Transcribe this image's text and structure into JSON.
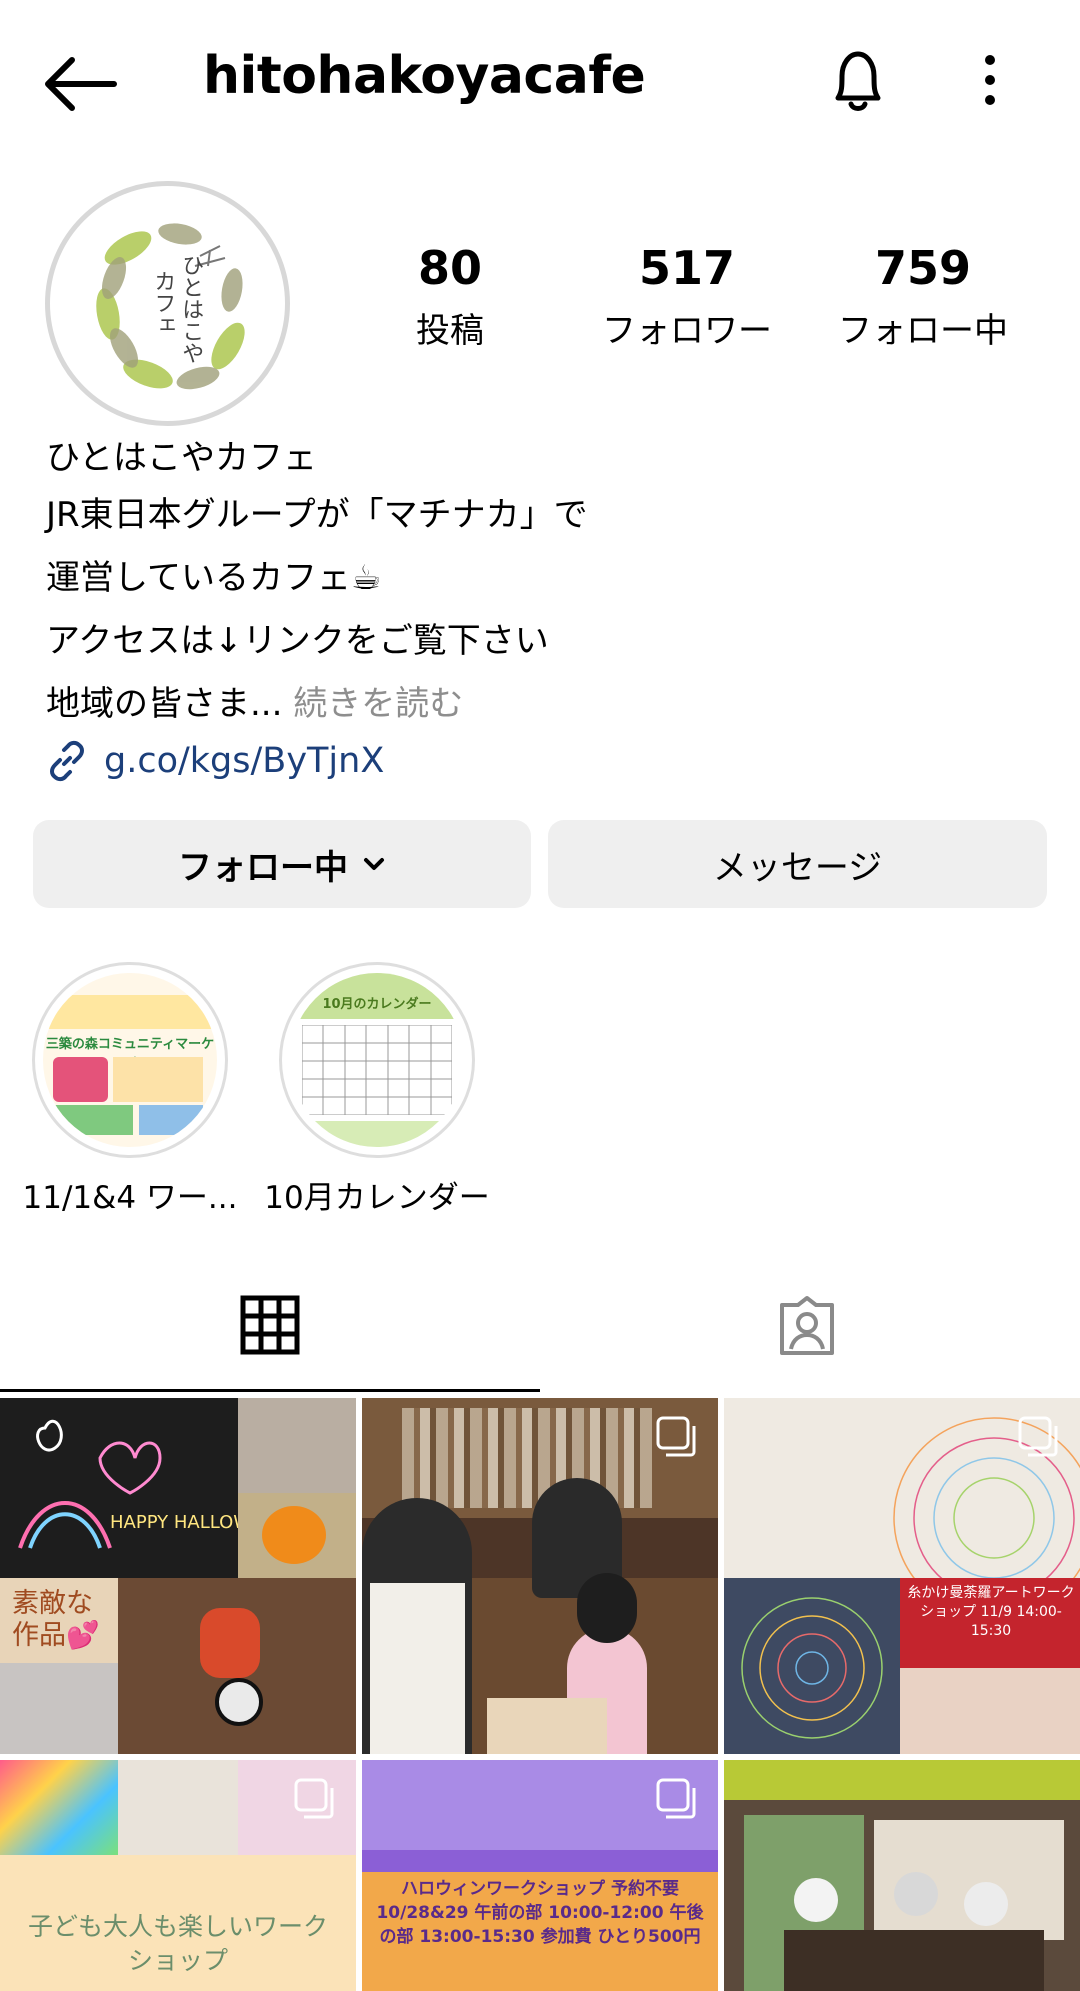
{
  "header": {
    "username": "hitohakoyacafe"
  },
  "avatar": {
    "text_line1": "ひとはこや",
    "text_line2": "カフェ"
  },
  "stats": [
    {
      "count": "80",
      "label": "投稿"
    },
    {
      "count": "517",
      "label": "フォロワー"
    },
    {
      "count": "759",
      "label": "フォロー中"
    }
  ],
  "bio": {
    "name": "ひとはこやカフェ",
    "line1": "JR東日本グループが「マチナカ」で",
    "line2": "運営しているカフェ☕",
    "line3": "アクセスは↓リンクをご覧下さい",
    "line4": "地域の皆さま...",
    "more": " 続きを読む",
    "link": "g.co/kgs/ByTjnX"
  },
  "buttons": {
    "following": "フォロー中",
    "message": "メッセージ"
  },
  "highlights": [
    {
      "label": "11/1&4 ワー...",
      "cover_title": "三築の森コミュニティマーケット"
    },
    {
      "label": "10月カレンダー",
      "cover_title": "10月のカレンダー"
    }
  ],
  "posts": [
    {
      "overlay_text": "素敵な作品💕"
    },
    {
      "overlay_text": ""
    },
    {
      "overlay_text": "糸かけ曼荼羅アートワークショップ 11/9 14:00-15:30"
    },
    {
      "overlay_text": "子ども大人も楽しいワークショップ"
    },
    {
      "overlay_text": "ハロウィンワークショップ 予約不要 10/28&29 午前の部 10:00-12:00 午後の部 13:00-15:30 参加費 ひとり500円"
    },
    {
      "overlay_text": ""
    }
  ],
  "colors": {
    "link": "#1c3f7a",
    "button_bg": "#efefef",
    "muted": "#8e8e8e"
  }
}
